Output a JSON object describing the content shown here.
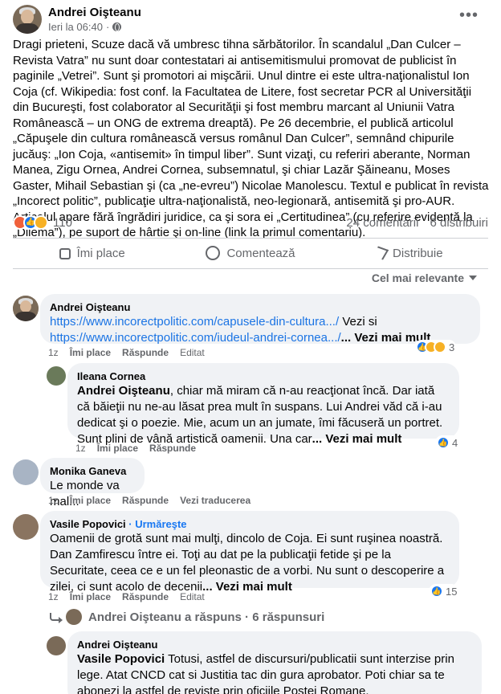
{
  "post": {
    "author": "Andrei Oişteanu",
    "time": "Ieri la 06:40",
    "more_label": "•••",
    "text": "Dragi prieteni, Scuze dacă vă umbresc tihna sărbătorilor. În scandalul „Dan Culcer – Revista Vatra” nu sunt doar contestatari ai antisemitismului promovat de publicist în paginile „Vetrei”. Sunt şi promotori ai mişcării. Unul dintre ei este ultra-naţionalistul Ion Coja (cf. Wikipedia: fost conf. la Facultatea de Litere, fost secretar PCR al Universităţii din Bucureşti, fost colaborator al Securităţii şi fost membru marcant al Uniunii Vatra Românească – un ONG de extrema dreaptă). Pe 26 decembrie, el publică articolul „Căpuşele din cultura românească versus românul Dan Culcer”, semnând chipurile jucăuş: „Ion Coja, «antisemit» în timpul liber”. Sunt vizaţi, cu referiri aberante, Norman Manea, Zigu Ornea, Andrei Cornea, subsemnatul, şi chiar Lazăr Şăineanu, Moses Gaster, Mihail Sebastian şi (ca „ne-evreu”) Nicolae Manolescu. Textul e  publicat în revista „Incorect politic”, publicaţie ultra-naţionalistă, neo-legionară, antisemită şi pro-AUR. Articolul apare fără îngrădiri juridice, ca şi sora ei „Certitudinea” (cu referire evidentă la „Dilema”), pe suport de hârtie şi on-line (link la primul comentariu).",
    "reaction_count": "110",
    "comments_count": "24 comentarii",
    "shares_count": "6 distribuiri"
  },
  "actions": {
    "like": "Îmi place",
    "comment": "Comentează",
    "share": "Distribuie"
  },
  "sort_label": "Cel mai relevante",
  "comments": [
    {
      "name": "Andrei Oişteanu",
      "link1": "https://www.incorectpolitic.com/capusele-din-cultura.../",
      "mid": " Vezi si",
      "link2": "https://www.incorectpolitic.com/iudeul-andrei-cornea.../",
      "see_more": "... Vezi mai mult",
      "time": "1z",
      "like": "Îmi place",
      "reply": "Răspunde",
      "edited": "Editat",
      "reactions": "3"
    },
    {
      "name": "Ileana Cornea",
      "mention": "Andrei Oişteanu",
      "text": ", chiar mă miram că n-au reacţionat încă. Dar iată că băieţii nu ne-au lăsat prea mult în suspans. Lui Andrei văd că i-au dedicat şi o poezie. Mie, acum un an jumate, îmi făcuseră un portret. Sunt plini de vână artistică oamenii. Una car",
      "see_more": "... Vezi mai mult",
      "time": "1z",
      "like": "Îmi place",
      "reply": "Răspunde",
      "reactions": "4"
    },
    {
      "name": "Monika Ganeva",
      "text": "Le monde va mal...",
      "time": "1z",
      "like": "Îmi place",
      "reply": "Răspunde",
      "translate": "Vezi traducerea"
    },
    {
      "name": "Vasile Popovici",
      "follow": " · Urmăreşte",
      "text": "Oamenii de grotă sunt mai mulţi, dincolo de Coja. Ei sunt ruşinea noastră. Dan Zamfirescu între ei. Toţi au dat pe la publicaţii fetide şi pe la Securitate, ceea ce e un fel pleonastic de a vorbi. Nu sunt o descoperire a zilei, ci sunt acolo de decenii",
      "see_more": "... Vezi mai mult",
      "time": "1z",
      "like": "Îmi place",
      "reply": "Răspunde",
      "edited": "Editat",
      "reactions": "15"
    },
    {
      "name": "Andrei Oişteanu",
      "mention": "Vasile Popovici",
      "text": " Totusi, astfel de discursuri/publicatii sunt interzise prin lege. Atat CNCD cat si Justitia tac din gura aprobator. Poti chiar sa te abonezi la astfel de reviste prin oficiile Postei Romane."
    }
  ],
  "replies_summary": {
    "author": "Andrei Oişteanu a răspuns",
    "count": " · 6 răspunsuri"
  }
}
